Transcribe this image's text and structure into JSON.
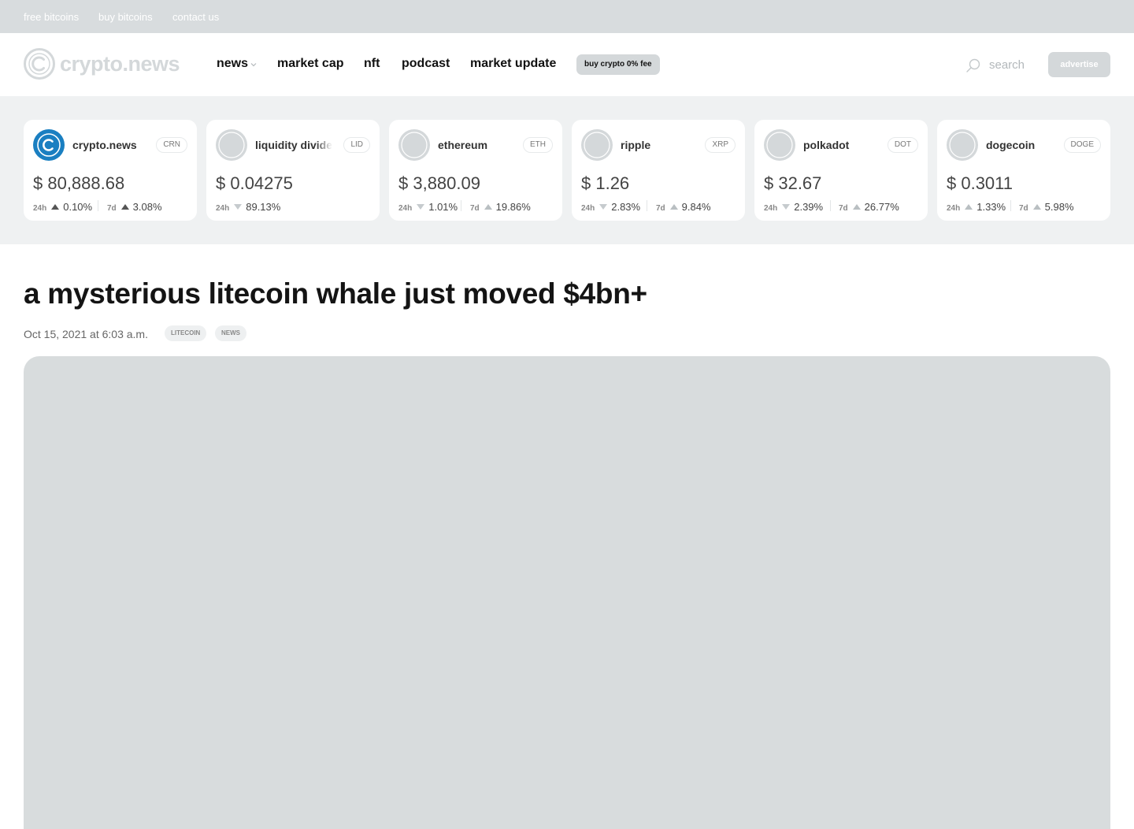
{
  "topbar": {
    "links": [
      "free bitcoins",
      "buy bitcoins",
      "contact us"
    ]
  },
  "header": {
    "logo_text": "crypto.news",
    "nav": [
      "news",
      "market cap",
      "nft",
      "podcast",
      "market update"
    ],
    "promo": "buy crypto 0% fee",
    "search": "search",
    "advertise": "advertise"
  },
  "ticker": [
    {
      "name": "crypto.news",
      "symbol": "CRN",
      "price": "$ 80,888.68",
      "d24_label": "24h",
      "d24": "0.10%",
      "d24_dir": "up",
      "d7_label": "7d",
      "d7": "3.08%",
      "d7_dir": "up"
    },
    {
      "name": "liquidity dividends",
      "symbol": "LID",
      "price": "$ 0.04275",
      "d24_label": "24h",
      "d24": "89.13%",
      "d24_dir": "down"
    },
    {
      "name": "ethereum",
      "symbol": "ETH",
      "price": "$ 3,880.09",
      "d24_label": "24h",
      "d24": "1.01%",
      "d24_dir": "down",
      "d7_label": "7d",
      "d7": "19.86%",
      "d7_dir": "up"
    },
    {
      "name": "ripple",
      "symbol": "XRP",
      "price": "$ 1.26",
      "d24_label": "24h",
      "d24": "2.83%",
      "d24_dir": "down",
      "d7_label": "7d",
      "d7": "9.84%",
      "d7_dir": "up"
    },
    {
      "name": "polkadot",
      "symbol": "DOT",
      "price": "$ 32.67",
      "d24_label": "24h",
      "d24": "2.39%",
      "d24_dir": "down",
      "d7_label": "7d",
      "d7": "26.77%",
      "d7_dir": "up"
    },
    {
      "name": "dogecoin",
      "symbol": "DOGE",
      "price": "$ 0.3011",
      "d24_label": "24h",
      "d24": "1.33%",
      "d24_dir": "up",
      "d7_label": "7d",
      "d7": "5.98%",
      "d7_dir": "up"
    }
  ],
  "article": {
    "title": "a mysterious litecoin whale just moved $4bn+",
    "date": "Oct 15, 2021 at 6:03 a.m.",
    "tags": [
      "LITECOIN",
      "NEWS"
    ]
  },
  "colors": {
    "accent": "#1a7fc1",
    "topbar": "#d8dcde",
    "ticker_bg": "#eff1f2",
    "hero": "#d8dcdd"
  }
}
